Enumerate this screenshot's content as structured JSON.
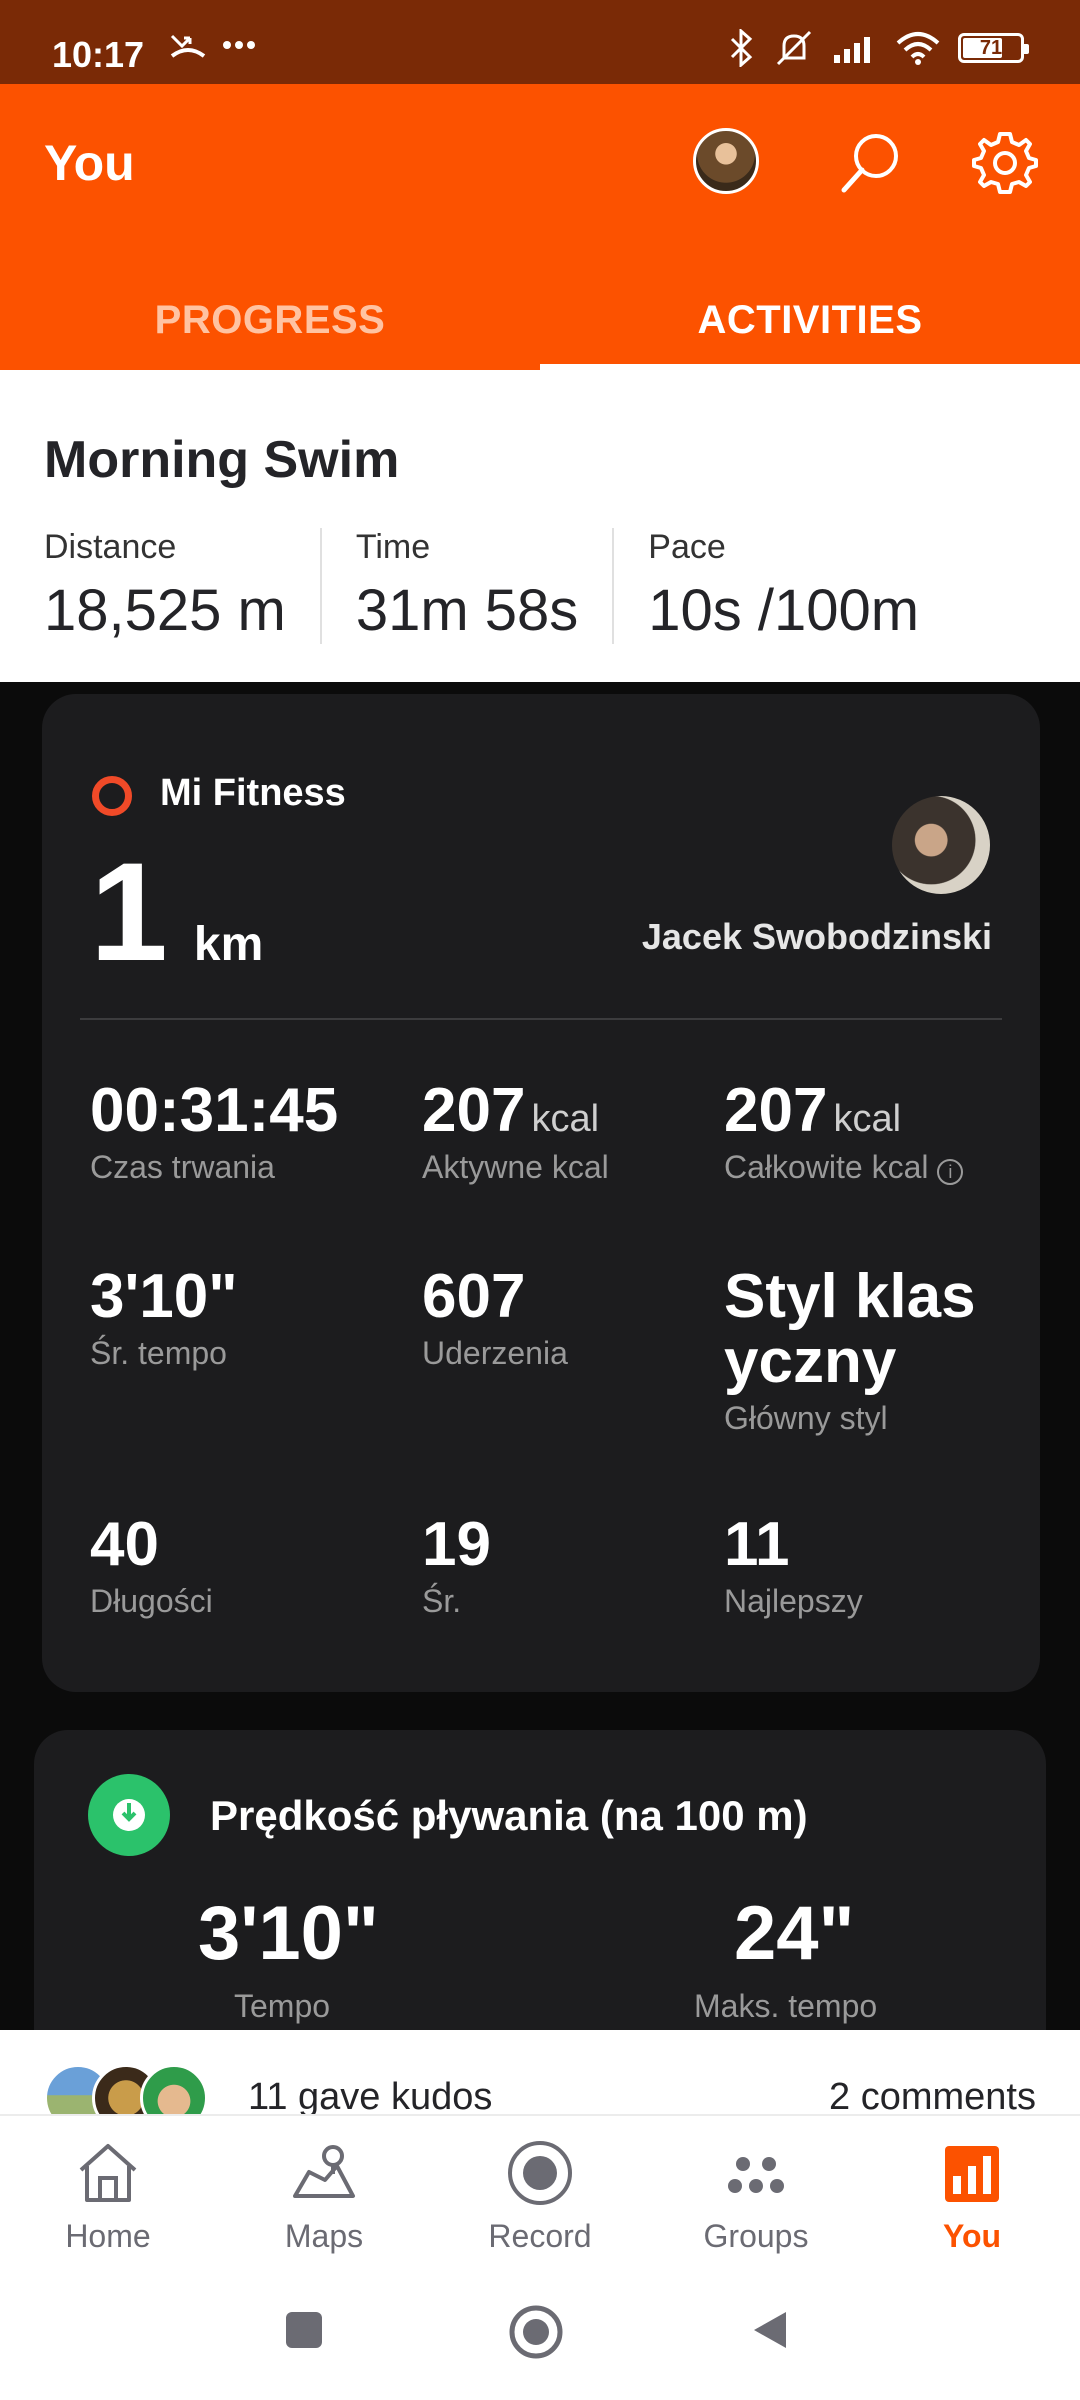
{
  "status_bar": {
    "time": "10:17",
    "battery": "71",
    "battery_level": 0.71
  },
  "header": {
    "title": "You"
  },
  "tabs": [
    {
      "label": "PROGRESS",
      "active": false
    },
    {
      "label": "ACTIVITIES",
      "active": true
    }
  ],
  "activity": {
    "title": "Morning Swim",
    "stats": [
      {
        "label": "Distance",
        "value": "18,525 m"
      },
      {
        "label": "Time",
        "value": "31m 58s"
      },
      {
        "label": "Pace",
        "value": "10s /100m"
      }
    ]
  },
  "mi_card": {
    "brand": "Mi Fitness",
    "distance_value": "1",
    "distance_unit": "km",
    "user_name": "Jacek Swobodzinski",
    "cells": {
      "duration": {
        "value": "00:31:45",
        "label": "Czas trwania"
      },
      "active_kcal": {
        "value": "207",
        "unit": "kcal",
        "label": "Aktywne kcal"
      },
      "total_kcal": {
        "value": "207",
        "unit": "kcal",
        "label": "Całkowite kcal"
      },
      "avg_pace": {
        "value": "3'10\"",
        "label": "Śr. tempo"
      },
      "strokes": {
        "value": "607",
        "label": "Uderzenia"
      },
      "style_line1": "Styl klas",
      "style_line2": "yczny",
      "style_label": "Główny styl",
      "lengths": {
        "value": "40",
        "label": "Długości"
      },
      "avg": {
        "value": "19",
        "label": "Śr."
      },
      "best": {
        "value": "11",
        "label": "Najlepszy"
      }
    }
  },
  "speed_card": {
    "title": "Prędkość pływania (na 100 m)",
    "pace_value": "3'10\"",
    "pace_label": "Tempo",
    "max_value": "24\"",
    "max_label": "Maks. tempo"
  },
  "social": {
    "kudos": "11 gave kudos",
    "comments": "2 comments"
  },
  "bottom_nav": [
    {
      "label": "Home",
      "icon": "home-icon"
    },
    {
      "label": "Maps",
      "icon": "maps-icon"
    },
    {
      "label": "Record",
      "icon": "record-icon"
    },
    {
      "label": "Groups",
      "icon": "groups-icon"
    },
    {
      "label": "You",
      "icon": "you-icon",
      "active": true
    }
  ],
  "colors": {
    "brand_orange": "#fc5200",
    "status_bar": "#7a2a06",
    "mi_red": "#f04a28",
    "speed_green": "#2bc26b"
  }
}
